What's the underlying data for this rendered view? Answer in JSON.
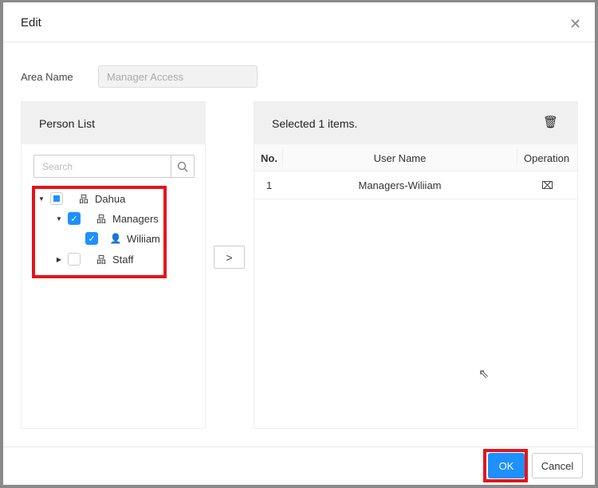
{
  "dialog": {
    "title": "Edit"
  },
  "area": {
    "label": "Area Name",
    "value": "Manager Access"
  },
  "person_list": {
    "title": "Person List",
    "search_placeholder": "Search",
    "tree": [
      {
        "label": "Dahua",
        "state": "partial",
        "expanded": true
      },
      {
        "label": "Managers",
        "state": "checked",
        "expanded": true
      },
      {
        "label": "Wiliiam",
        "state": "checked"
      },
      {
        "label": "Staff",
        "state": "unchecked",
        "expanded": false
      }
    ]
  },
  "transfer": {
    "label": ">"
  },
  "selected": {
    "title": "Selected 1 items.",
    "columns": [
      "No.",
      "User Name",
      "Operation"
    ],
    "rows": [
      {
        "no": "1",
        "name": "Managers-Wiliiam"
      }
    ]
  },
  "footer": {
    "ok": "OK",
    "cancel": "Cancel"
  },
  "colors": {
    "accent": "#1e90ff",
    "highlight": "#e3151a"
  }
}
